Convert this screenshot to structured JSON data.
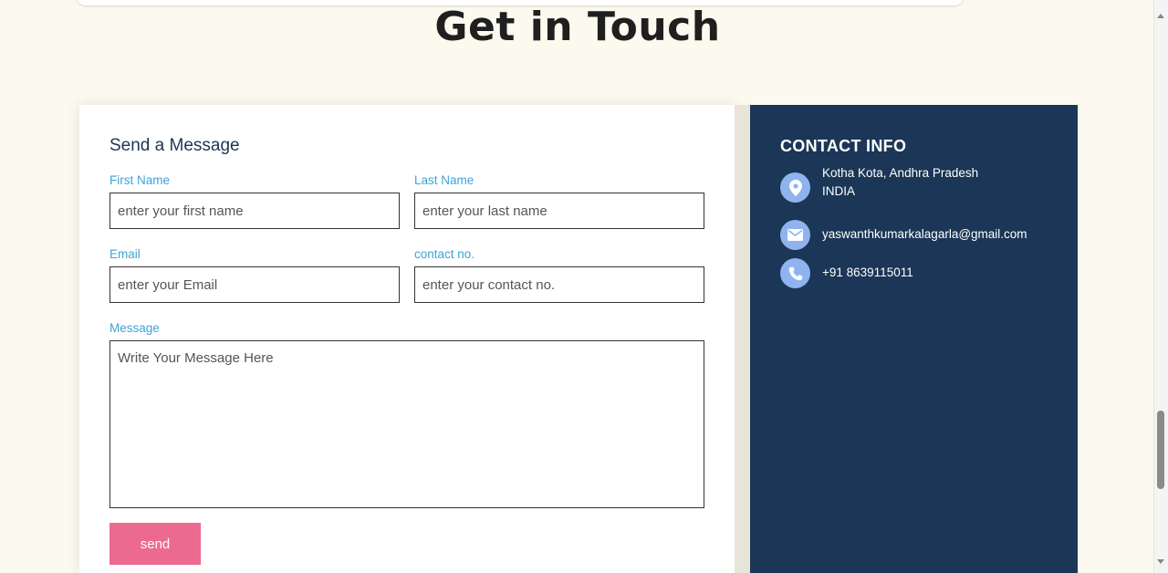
{
  "page": {
    "title": "Get in Touch"
  },
  "form": {
    "heading": "Send a Message",
    "first_name": {
      "label": "First Name",
      "placeholder": "enter your first name",
      "value": ""
    },
    "last_name": {
      "label": "Last Name",
      "placeholder": "enter your last name",
      "value": ""
    },
    "email": {
      "label": "Email",
      "placeholder": "enter your Email",
      "value": ""
    },
    "contact": {
      "label": "contact no.",
      "placeholder": "enter your contact no.",
      "value": ""
    },
    "message": {
      "label": "Message",
      "placeholder": "Write Your Message Here",
      "value": ""
    },
    "send_label": "send"
  },
  "contact_info": {
    "heading": "CONTACT INFO",
    "address_line1": "Kotha Kota, Andhra Pradesh",
    "address_line2": "INDIA",
    "email": "yaswanthkumarkalagarla@gmail.com",
    "phone": "+91 8639115011",
    "icons": [
      "location-pin-icon",
      "mail-icon",
      "phone-icon"
    ]
  },
  "colors": {
    "page_background": "#fcf9ee",
    "info_panel": "#1b3656",
    "label_accent": "#3ea3d8",
    "send_button": "#ec6a90",
    "icon_circle": "#8fb3ee"
  }
}
